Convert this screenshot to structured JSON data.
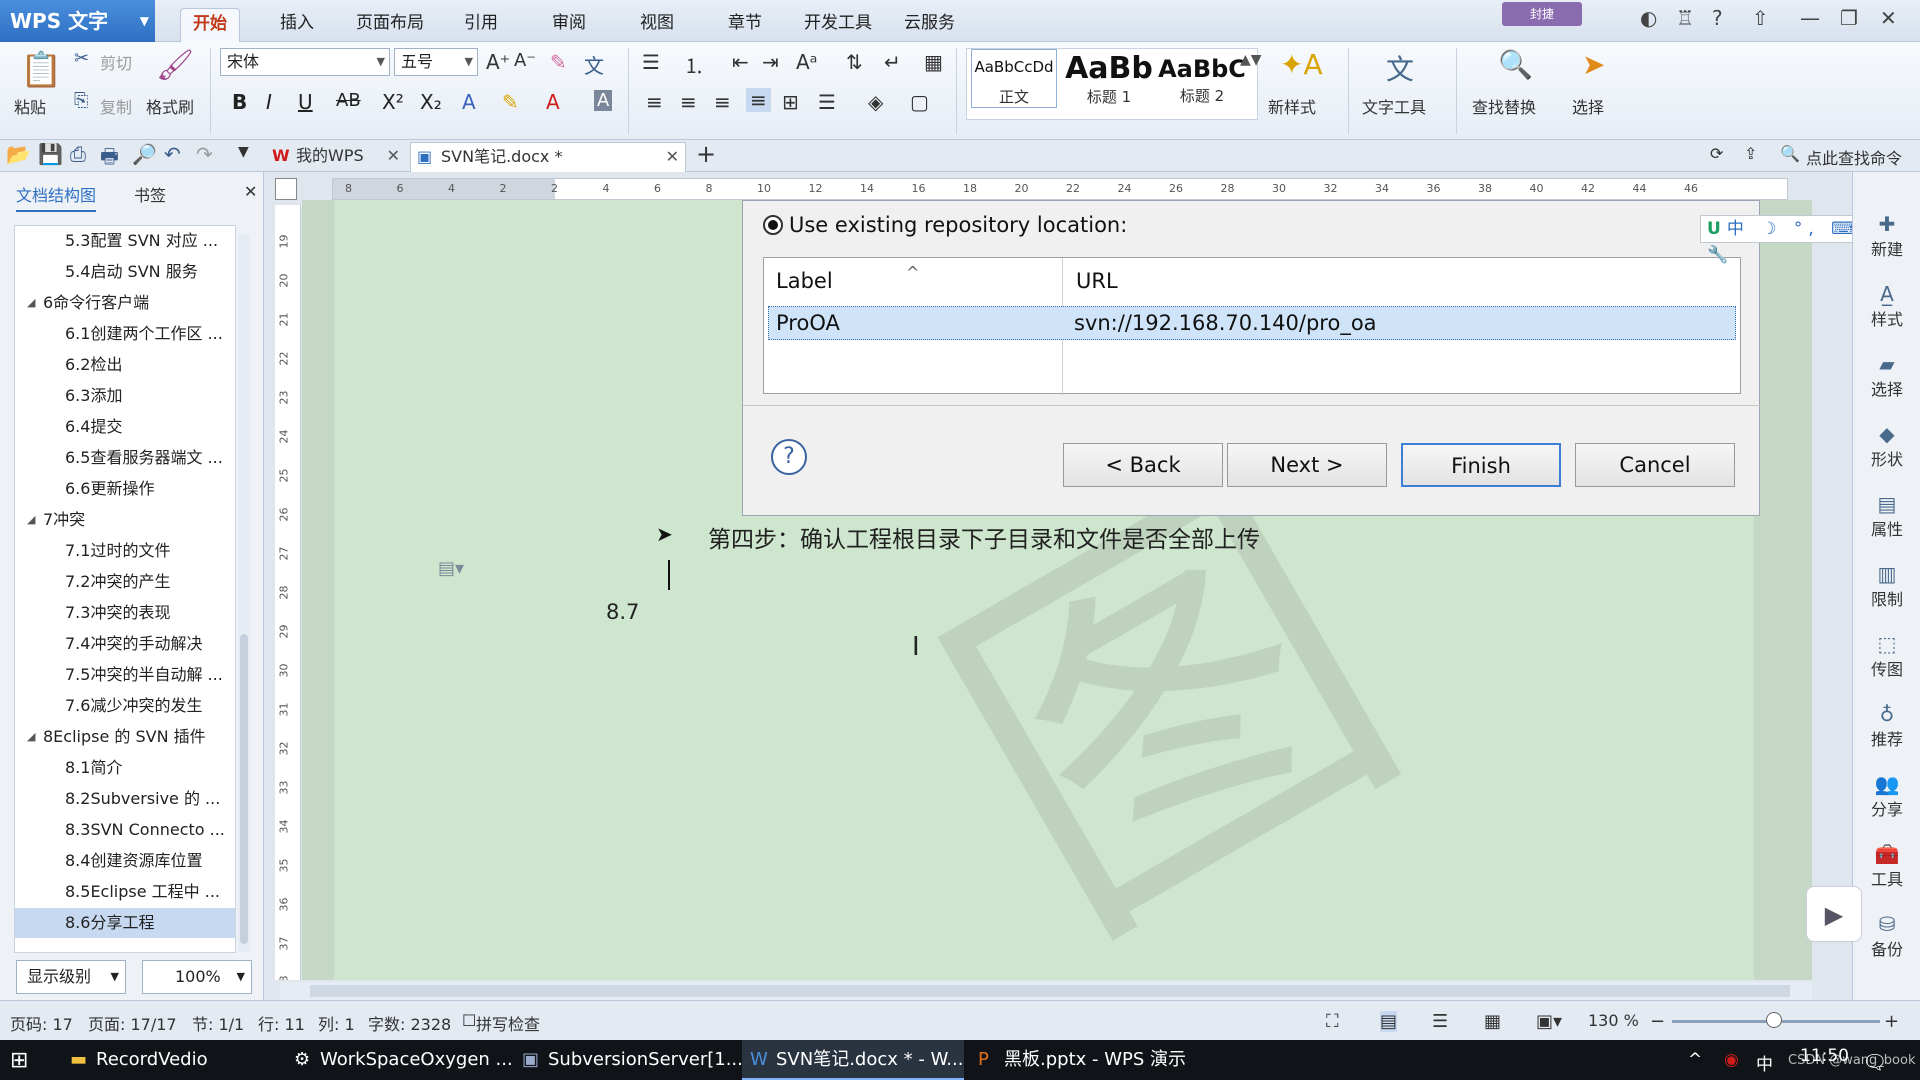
{
  "app": {
    "name": "WPS 文字",
    "menu_tabs": [
      "开始",
      "插入",
      "页面布局",
      "引用",
      "审阅",
      "视图",
      "章节",
      "开发工具",
      "云服务"
    ],
    "user_label": "封捷"
  },
  "ribbon": {
    "paste": "粘贴",
    "cut": "剪切",
    "copy": "复制",
    "format_painter": "格式刷",
    "font": "宋体",
    "size": "五号",
    "styles": [
      {
        "sample": "AaBbCcDd",
        "name": "正文"
      },
      {
        "sample": "AaBb",
        "name": "标题 1"
      },
      {
        "sample": "AaBbC",
        "name": "标题 2"
      }
    ],
    "new_style": "新样式",
    "text_tools": "文字工具",
    "find_replace": "查找替换",
    "select": "选择"
  },
  "tabs": {
    "items": [
      {
        "label": "我的WPS"
      },
      {
        "label": "SVN笔记.docx *"
      }
    ],
    "quick_search": "点此查找命令"
  },
  "nav": {
    "tab_outline": "文档结构图",
    "tab_bookmark": "书签",
    "items": [
      {
        "label": "5.3配置 SVN 对应 ...",
        "level": 2
      },
      {
        "label": "5.4启动 SVN 服务",
        "level": 2
      },
      {
        "label": "6命令行客户端",
        "level": 1
      },
      {
        "label": "6.1创建两个工作区 ...",
        "level": 2
      },
      {
        "label": "6.2检出",
        "level": 2
      },
      {
        "label": "6.3添加",
        "level": 2
      },
      {
        "label": "6.4提交",
        "level": 2
      },
      {
        "label": "6.5查看服务器端文 ...",
        "level": 2
      },
      {
        "label": "6.6更新操作",
        "level": 2
      },
      {
        "label": "7冲突",
        "level": 1
      },
      {
        "label": "7.1过时的文件",
        "level": 2
      },
      {
        "label": "7.2冲突的产生",
        "level": 2
      },
      {
        "label": "7.3冲突的表现",
        "level": 2
      },
      {
        "label": "7.4冲突的手动解决",
        "level": 2
      },
      {
        "label": "7.5冲突的半自动解 ...",
        "level": 2
      },
      {
        "label": "7.6减少冲突的发生",
        "level": 2
      },
      {
        "label": "8Eclipse 的 SVN 插件",
        "level": 1
      },
      {
        "label": "8.1简介",
        "level": 2
      },
      {
        "label": "8.2Subversive 的 ...",
        "level": 2
      },
      {
        "label": "8.3SVN Connecto ...",
        "level": 2
      },
      {
        "label": "8.4创建资源库位置",
        "level": 2
      },
      {
        "label": "8.5Eclipse 工程中 ...",
        "level": 2
      },
      {
        "label": "8.6分享工程",
        "level": 2,
        "selected": true
      }
    ],
    "display_level": "显示级别",
    "zoom": "100%"
  },
  "ruler": {
    "h_ticks": [
      "8",
      "6",
      "4",
      "2",
      "2",
      "4",
      "6",
      "8",
      "10",
      "12",
      "14",
      "16",
      "18",
      "20",
      "22",
      "24",
      "26",
      "28",
      "30",
      "32",
      "34",
      "36",
      "38",
      "40",
      "42",
      "44",
      "46"
    ],
    "v_ticks": [
      "19",
      "20",
      "21",
      "22",
      "23",
      "24",
      "25",
      "26",
      "27",
      "28",
      "29",
      "30",
      "31",
      "32",
      "33",
      "34",
      "35",
      "36",
      "37",
      "38"
    ]
  },
  "dialog": {
    "radio_label": "Use existing repository location:",
    "col_label": "Label",
    "col_url": "URL",
    "row_label": "ProOA",
    "row_url": "svn://192.168.70.140/pro_oa",
    "back": "< Back",
    "next": "Next >",
    "finish": "Finish",
    "cancel": "Cancel"
  },
  "doc": {
    "step_text": "第四步：确认工程根目录下子目录和文件是否全部上传",
    "para_num": "8.7",
    "watermark": "图"
  },
  "right_sidebar": [
    "新建",
    "样式",
    "选择",
    "形状",
    "属性",
    "限制",
    "传图",
    "推荐",
    "分享",
    "工具",
    "备份"
  ],
  "ime": "中 ☽ °, ⌨ 👤 🔧",
  "status": {
    "page": "页码: 17",
    "pages": "页面: 17/17",
    "section": "节: 1/1",
    "row": "行: 11",
    "col": "列: 1",
    "words": "字数: 2328",
    "spell": "拼写检查",
    "zoom": "130 %"
  },
  "taskbar": {
    "items": [
      "RecordVedio",
      "WorkSpaceOxygen ...",
      "SubversionServer[1...",
      "SVN笔记.docx * - W...",
      "黑板.pptx - WPS 演示"
    ],
    "clock": "11:50",
    "ime": "中",
    "watermark_text": "CSDN @wang_book"
  }
}
